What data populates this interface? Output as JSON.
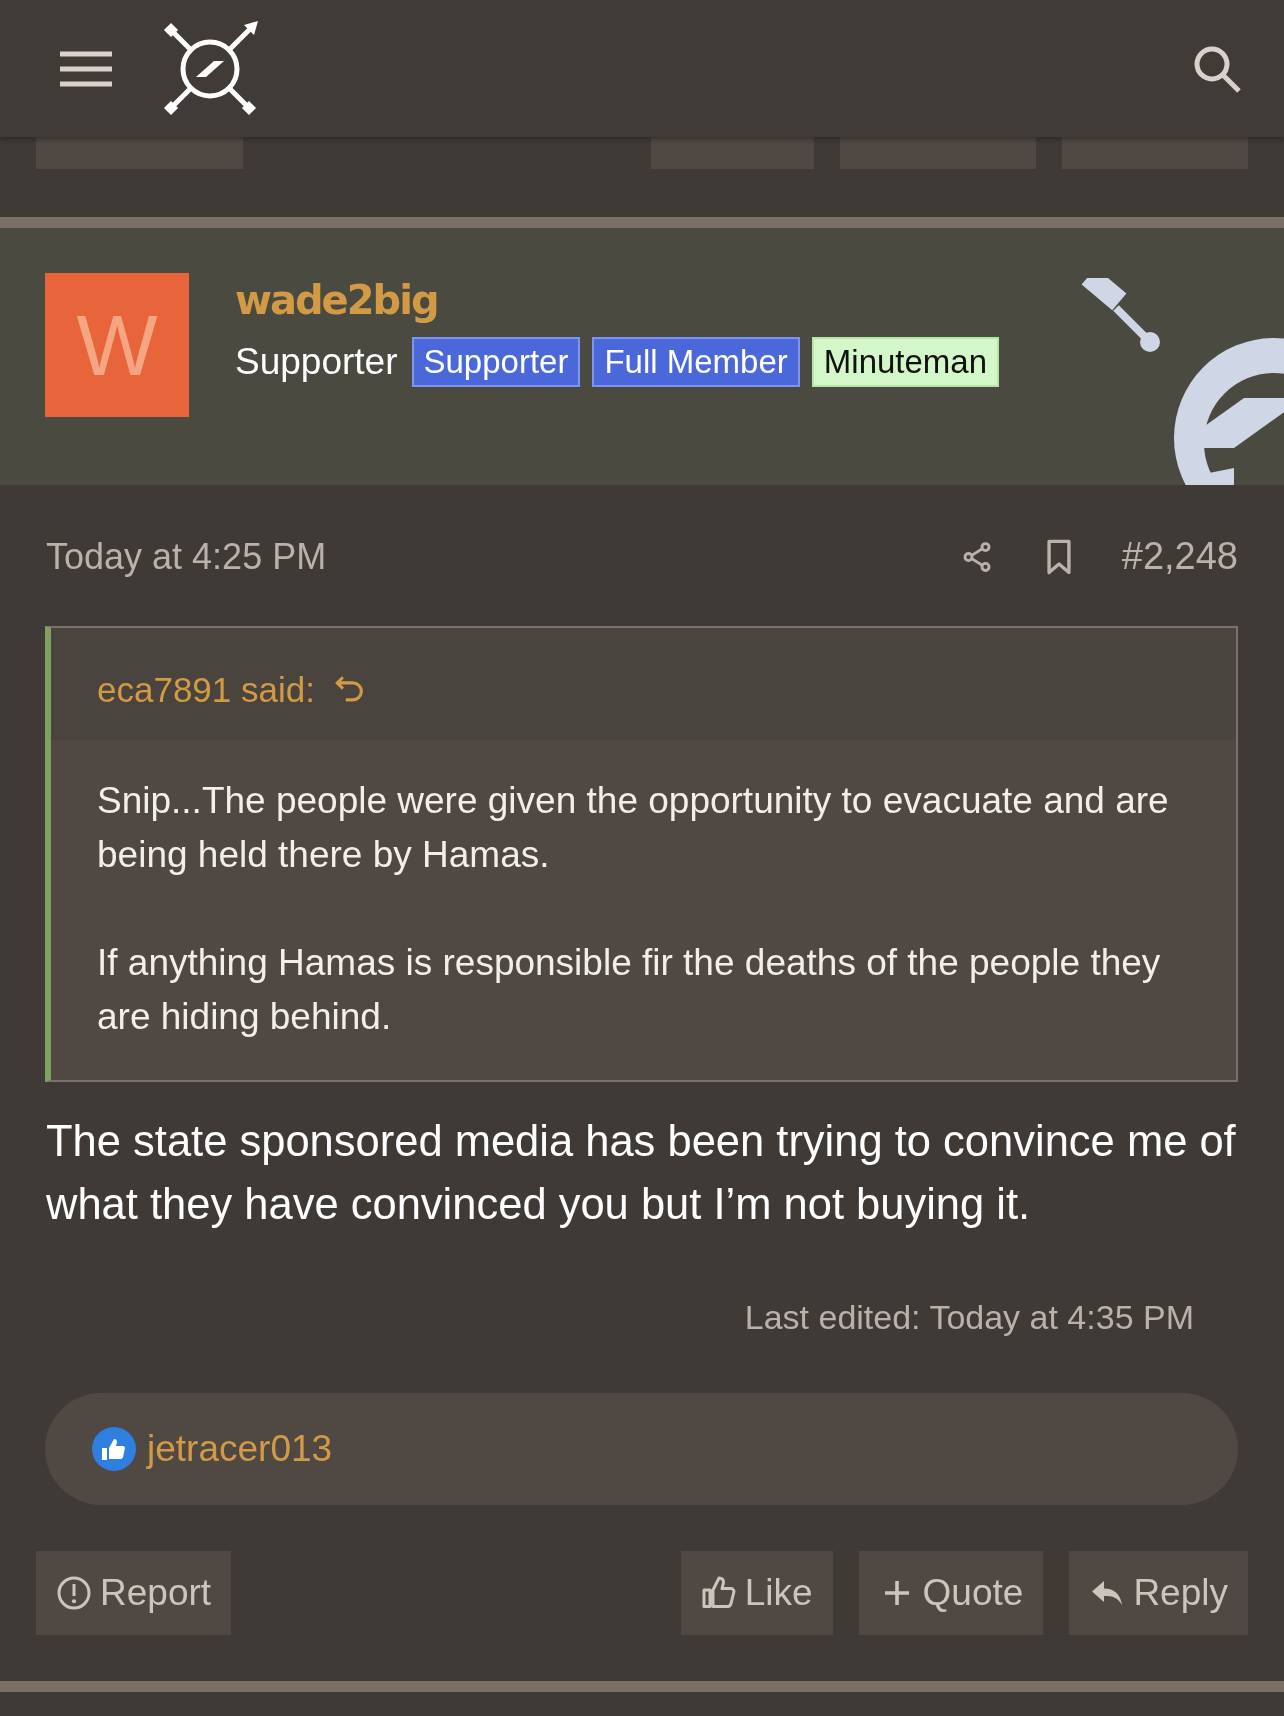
{
  "header": {
    "hidden_actions": [
      {
        "kind": "report"
      },
      {
        "kind": "like"
      },
      {
        "kind": "quote"
      },
      {
        "kind": "reply"
      }
    ]
  },
  "post": {
    "author": "wade2big",
    "avatar_letter": "W",
    "user_title": "Supporter",
    "banners": [
      {
        "label": "Supporter",
        "kind": "blue"
      },
      {
        "label": "Full Member",
        "kind": "blue"
      },
      {
        "label": "Minuteman",
        "kind": "green"
      }
    ],
    "date": "Today at 4:25 PM",
    "number": "#2,248",
    "quote": {
      "author": "eca7891 said:",
      "paragraphs": [
        "Snip...The people were given the opportunity to evacuate and are being held there by Hamas.",
        "If anything Hamas is responsible fir the deaths of the people they are hiding behind."
      ]
    },
    "body": "The state sponsored media has been trying to convince me of what they have convinced you but I’m not buying it.",
    "last_edited": "Last edited: Today at 4:35 PM",
    "reactions": {
      "users": "jetracer013"
    },
    "actions": [
      {
        "kind": "report",
        "label": "Report"
      },
      {
        "kind": "like",
        "label": "Like"
      },
      {
        "kind": "quote",
        "label": "Quote"
      },
      {
        "kind": "reply",
        "label": "Reply"
      }
    ]
  }
}
